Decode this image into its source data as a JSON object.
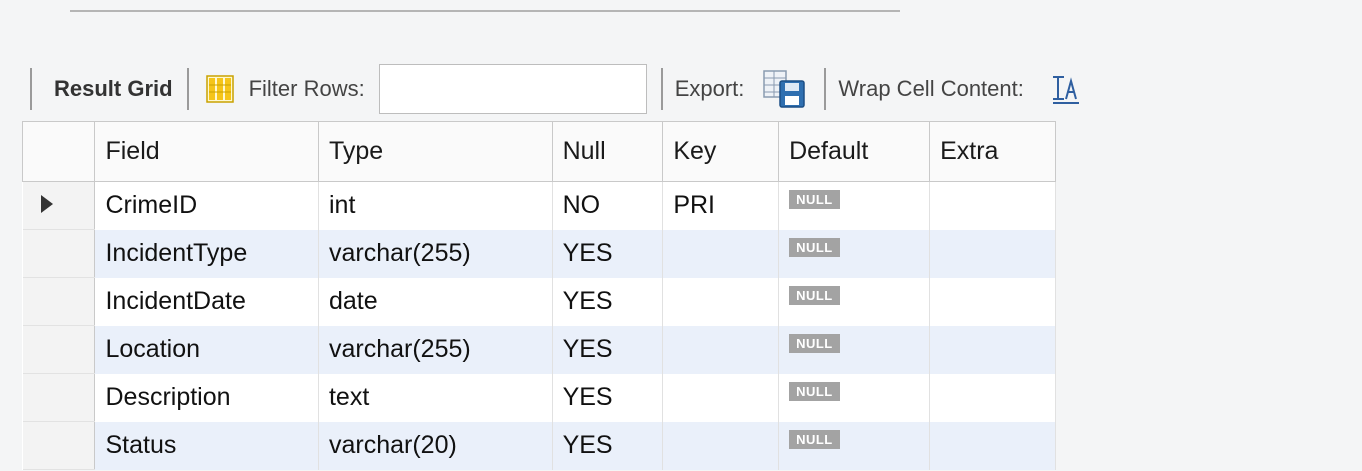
{
  "toolbar": {
    "result_grid_label": "Result Grid",
    "filter_rows_label": "Filter Rows:",
    "filter_rows_value": "",
    "export_label": "Export:",
    "wrap_cell_label": "Wrap Cell Content:"
  },
  "icons": {
    "grid_form_toggle": "grid-columns-icon",
    "export": "export-save-icon",
    "wrap": "wrap-text-icon",
    "row_pointer": "current-row-arrow-icon"
  },
  "colors": {
    "row_alt": "#eaf0fa",
    "null_badge": "#a3a3a3",
    "icon_yellow": "#f5c518"
  },
  "columns": [
    "Field",
    "Type",
    "Null",
    "Key",
    "Default",
    "Extra"
  ],
  "rows": [
    {
      "field": "CrimeID",
      "type": "int",
      "null": "NO",
      "key": "PRI",
      "default": "NULL",
      "extra": ""
    },
    {
      "field": "IncidentType",
      "type": "varchar(255)",
      "null": "YES",
      "key": "",
      "default": "NULL",
      "extra": ""
    },
    {
      "field": "IncidentDate",
      "type": "date",
      "null": "YES",
      "key": "",
      "default": "NULL",
      "extra": ""
    },
    {
      "field": "Location",
      "type": "varchar(255)",
      "null": "YES",
      "key": "",
      "default": "NULL",
      "extra": ""
    },
    {
      "field": "Description",
      "type": "text",
      "null": "YES",
      "key": "",
      "default": "NULL",
      "extra": ""
    },
    {
      "field": "Status",
      "type": "varchar(20)",
      "null": "YES",
      "key": "",
      "default": "NULL",
      "extra": ""
    }
  ]
}
